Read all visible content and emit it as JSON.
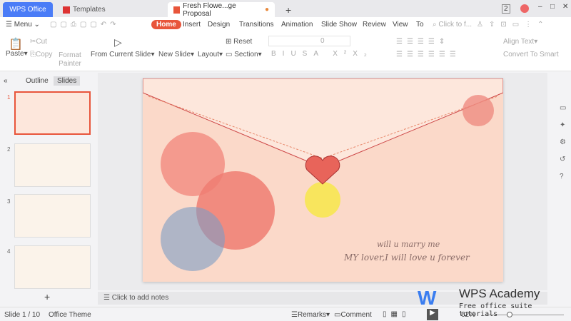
{
  "tabs": [
    {
      "label": "WPS Office"
    },
    {
      "label": "Templates"
    },
    {
      "label": "Fresh Flowe...ge Proposal"
    }
  ],
  "window": {
    "user_badge": "2"
  },
  "menu": {
    "menu_label": "Menu",
    "items": [
      "Home",
      "Insert",
      "Design",
      "Transitions",
      "Animation",
      "Slide Show",
      "Review",
      "View",
      "To"
    ],
    "search_placeholder": "Click to f..."
  },
  "ribbon": {
    "paste": "Paste",
    "cut": "Cut",
    "copy": "Copy",
    "format_painter": "Format Painter",
    "from_current_slide": "From Current Slide",
    "new_slide": "New Slide",
    "layout": "Layout",
    "reset": "Reset",
    "section": "Section",
    "font_size": "0",
    "align_text": "Align Text",
    "convert_smart": "Convert To Smart"
  },
  "panel": {
    "tab_outline": "Outline",
    "tab_slides": "Slides",
    "slides": [
      {
        "n": "1"
      },
      {
        "n": "2"
      },
      {
        "n": "3"
      },
      {
        "n": "4"
      }
    ],
    "add": "+"
  },
  "slide": {
    "line1": "will u marry me",
    "line2": "MY lover,I will love u forever"
  },
  "notes": {
    "placeholder": "Click to add notes"
  },
  "status": {
    "slide": "Slide 1 / 10",
    "theme": "Office Theme",
    "remarks": "Remarks",
    "comment": "Comment",
    "zoom": "62%"
  },
  "watermark": {
    "title": "WPS Academy",
    "subtitle": "Free office suite tutorials"
  },
  "colors": {
    "accent": "#e8553b",
    "wps_blue": "#4a7cf7",
    "slide_bg": "#fbd9c9"
  }
}
